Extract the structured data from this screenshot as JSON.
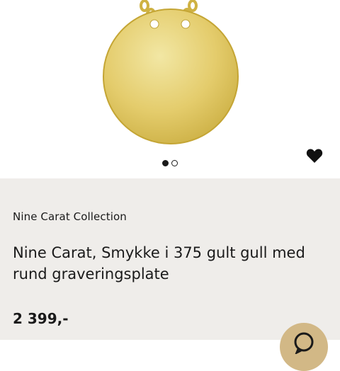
{
  "product": {
    "brand": "Nine Carat Collection",
    "title": "Nine Carat, Smykke i 375 gult gull med rund graveringsplate",
    "price": "2 399,-"
  },
  "gallery": {
    "slides": 2,
    "active_slide": 1
  },
  "icons": {
    "favorite": "heart-icon",
    "fab": "chat-icon"
  },
  "colors": {
    "info_background": "#efedea",
    "fab_background": "#d2b886",
    "text": "#1a1a1a"
  }
}
